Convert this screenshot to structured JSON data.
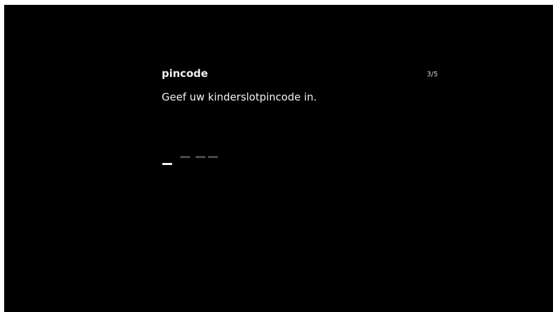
{
  "pin_dialog": {
    "title": "pincode",
    "step": "3/5",
    "instruction": "Geef uw kinderslotpincode in.",
    "digits": [
      {
        "state": "active"
      },
      {
        "state": "empty"
      },
      {
        "state": "empty"
      },
      {
        "state": "empty"
      }
    ]
  }
}
